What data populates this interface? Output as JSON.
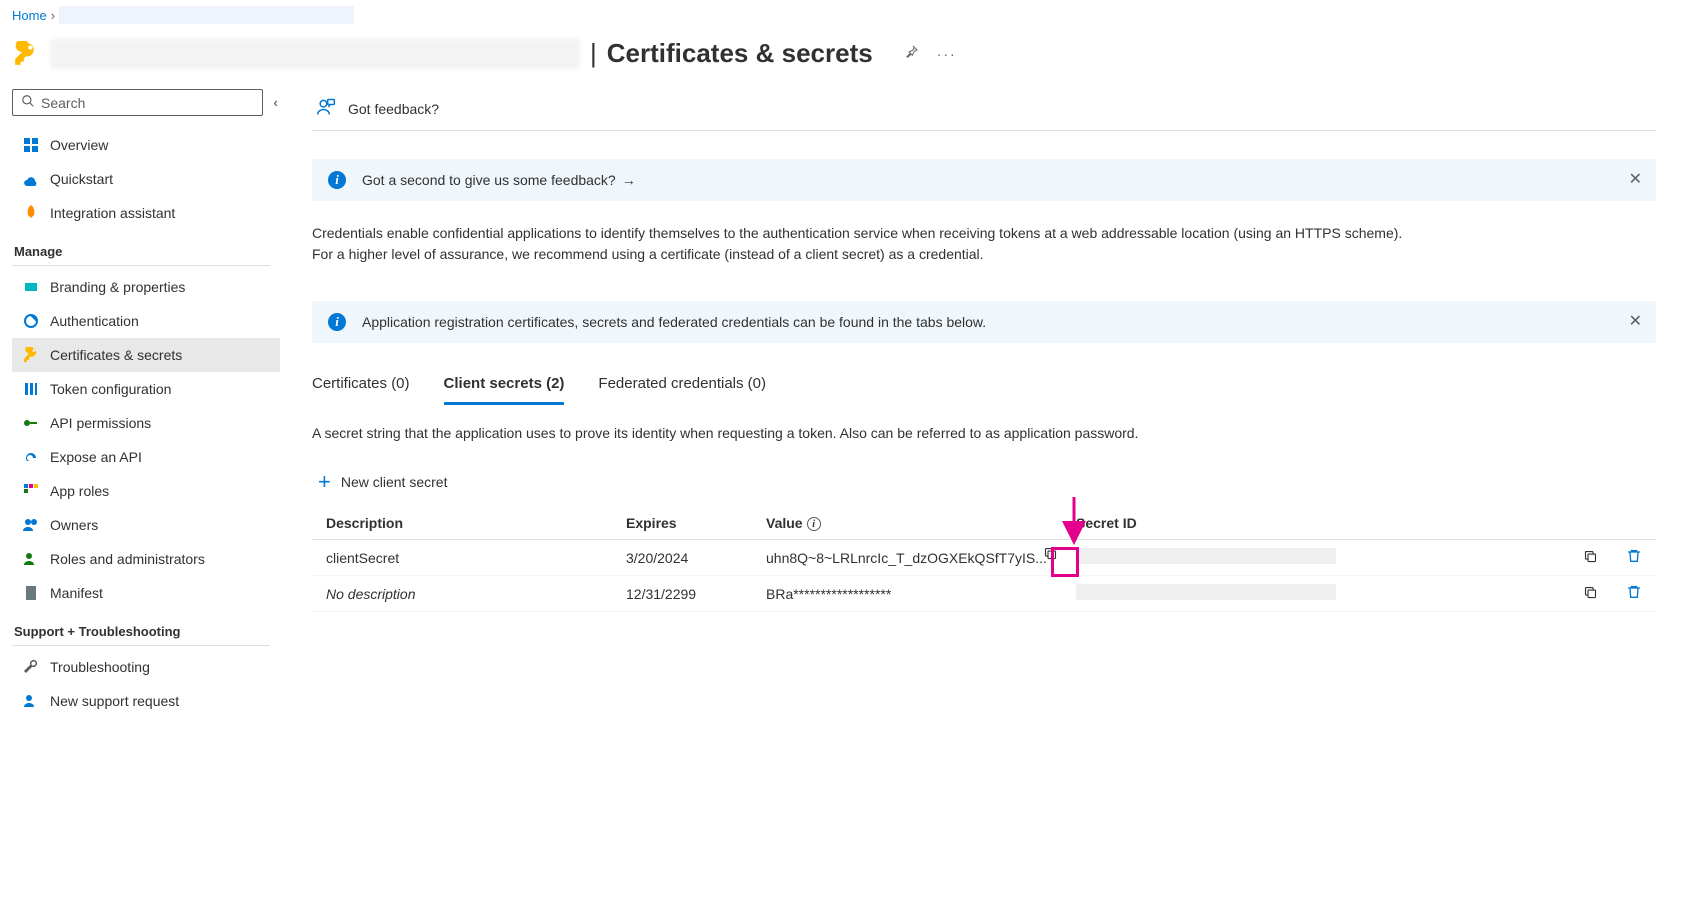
{
  "breadcrumb": {
    "home": "Home"
  },
  "page_title": "Certificates & secrets",
  "search": {
    "placeholder": "Search"
  },
  "nav": {
    "overview": "Overview",
    "quickstart": "Quickstart",
    "integration": "Integration assistant",
    "manage_header": "Manage",
    "branding": "Branding & properties",
    "authentication": "Authentication",
    "certificates": "Certificates & secrets",
    "token": "Token configuration",
    "api_perm": "API permissions",
    "expose": "Expose an API",
    "approles": "App roles",
    "owners": "Owners",
    "roles": "Roles and administrators",
    "manifest": "Manifest",
    "support_header": "Support + Troubleshooting",
    "troubleshooting": "Troubleshooting",
    "new_support": "New support request"
  },
  "feedback": {
    "label": "Got feedback?"
  },
  "banner1": {
    "text": "Got a second to give us some feedback?"
  },
  "description": "Credentials enable confidential applications to identify themselves to the authentication service when receiving tokens at a web addressable location (using an HTTPS scheme). For a higher level of assurance, we recommend using a certificate (instead of a client secret) as a credential.",
  "banner2": {
    "text": "Application registration certificates, secrets and federated credentials can be found in the tabs below."
  },
  "tabs": {
    "certificates": "Certificates (0)",
    "client_secrets": "Client secrets (2)",
    "federated": "Federated credentials (0)"
  },
  "tab_description": "A secret string that the application uses to prove its identity when requesting a token. Also can be referred to as application password.",
  "new_secret_label": "New client secret",
  "table": {
    "headers": {
      "description": "Description",
      "expires": "Expires",
      "value": "Value",
      "secret_id": "Secret ID"
    },
    "rows": [
      {
        "description": "clientSecret",
        "expires": "3/20/2024",
        "value": "uhn8Q~8~LRLnrcIc_T_dzOGXEkQSfT7yIS...",
        "no_desc": false
      },
      {
        "description": "No description",
        "expires": "12/31/2299",
        "value": "BRa******************",
        "no_desc": true
      }
    ]
  }
}
